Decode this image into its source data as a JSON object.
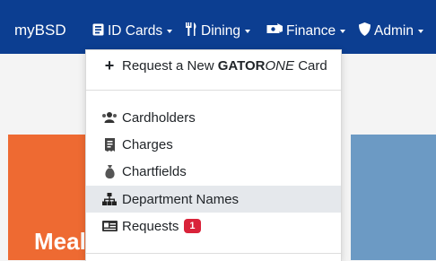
{
  "brand": "myBSD",
  "nav": {
    "items": [
      {
        "label": "ID Cards",
        "icon": "id-card-icon"
      },
      {
        "label": "Dining",
        "icon": "utensils-icon"
      },
      {
        "label": "Finance",
        "icon": "money-bill-icon"
      },
      {
        "label": "Admin",
        "icon": "shield-icon"
      }
    ]
  },
  "dropdown": {
    "request_new": {
      "prefix": "Request a New ",
      "bold": "GATOR",
      "italic": "ONE",
      "suffix": " Card"
    },
    "items": [
      {
        "label": "Cardholders",
        "icon": "users-icon"
      },
      {
        "label": "Charges",
        "icon": "receipt-icon"
      },
      {
        "label": "Chartfields",
        "icon": "money-bag-icon"
      },
      {
        "label": "Department Names",
        "icon": "sitemap-icon"
      },
      {
        "label": "Requests",
        "icon": "id-badge-icon",
        "badge": "1"
      }
    ]
  },
  "hero": {
    "text": "Meal"
  },
  "colors": {
    "navbar": "#0c3e91",
    "orange": "#ee6a32",
    "blue": "#6c9ac4",
    "badge": "#d9233a"
  }
}
